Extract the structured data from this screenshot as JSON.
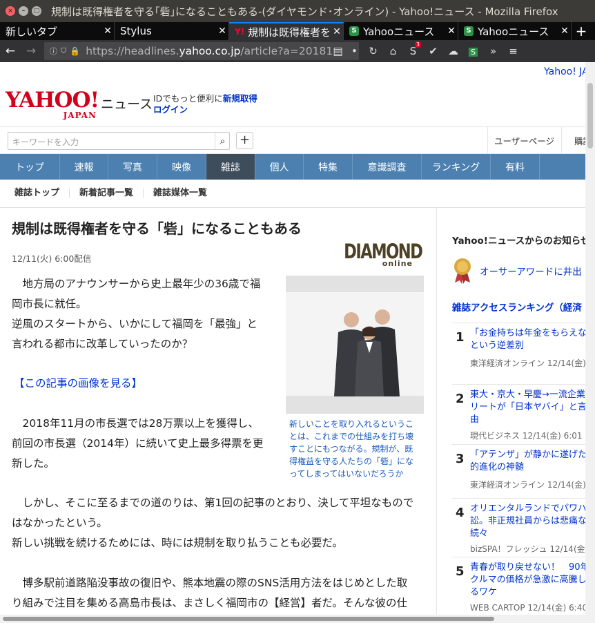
{
  "window": {
    "title": "規制は既得権者を守る｢砦｣になることもある-(ダイヤモンド･オンライン) - Yahoo!ニュース - Mozilla Firefox"
  },
  "tabs": [
    {
      "label": "新しいタブ"
    },
    {
      "label": "Stylus"
    },
    {
      "label": "規制は既得権者を守る"
    },
    {
      "label": "Yahooニュース"
    },
    {
      "label": "Yahooニュース"
    }
  ],
  "urlbar": {
    "proto": "https://headlines.",
    "host": "yahoo.co.jp",
    "path": "/article?a=20181"
  },
  "toolbar": {
    "badge_count": "3"
  },
  "header": {
    "top_link": "Yahoo! JA",
    "logo_main": "YAHOO!",
    "logo_sub": "JAPAN",
    "news_label": "ニュース",
    "id_text": "IDでもっと便利に",
    "signup": "新規取得",
    "login": "ログイン"
  },
  "search": {
    "placeholder": "キーワードを入力",
    "user_page": "ユーザーページ",
    "purchase": "購読"
  },
  "nav": [
    "トップ",
    "速報",
    "写真",
    "映像",
    "雑誌",
    "個人",
    "特集",
    "意識調査",
    "ランキング",
    "有料"
  ],
  "subnav": [
    "雑誌トップ",
    "新着記事一覧",
    "雑誌媒体一覧"
  ],
  "article": {
    "title": "規制は既得権者を守る「砦」になることもある",
    "date": "12/11(火) 6:00配信",
    "publisher_logo": "DIAMOND",
    "publisher_logo_sub": "online",
    "p1a": "　地方局のアナウンサーから史上最年少の36歳で福",
    "p1b": "岡市長に就任。",
    "p1c": "逆風のスタートから、いかにして福岡を「最強」と",
    "p1d": "言われる都市に改革していったのか？",
    "image_link": "【この記事の画像を見る】",
    "p2a": "　2018年11月の市長選では28万票以上を獲得し、",
    "p2b": "前回の市長選（2014年）に続いて史上最多得票を更",
    "p2c": "新した。",
    "p3a": "　しかし、そこに至るまでの道のりは、第1回の記事のとおり、決して平坦なもので",
    "p3b": "はなかったという。",
    "p3c": "新しい挑戦を続けるためには、時には規制を取り払うことも必要だ。",
    "p4a": "　博多駅前道路陥没事故の復旧や、熊本地震の際のSNS活用方法をはじめとした取",
    "p4b": "り組みで注目を集める高島市長は、まさしく福岡市の【経営】者だ。そんな彼の仕",
    "caption": "新しいことを取り入れるということは、これまでの仕組みを打ち壊すことにもつながる。規制が、既得権益を守る人たちの「砦」になってしまってはいないだろうか"
  },
  "sidebar": {
    "notice_heading": "Yahoo!ニュースからのお知らせ",
    "notice_link": "オーサーアワードに井出",
    "ranking_heading": "雑誌アクセスランキング（経済",
    "ranking": [
      {
        "num": "1",
        "l1": "「お金持ちは年金をもらえな",
        "l2": "という逆差別",
        "l3": "",
        "source": "東洋経済オンライン 12/14(金)"
      },
      {
        "num": "2",
        "l1": "東大・京大・早慶→一流企業",
        "l2": "リートが「日本ヤバイ」と言",
        "l3": "由",
        "source": "現代ビジネス 12/14(金) 6:01"
      },
      {
        "num": "3",
        "l1": "「アテンザ」が静かに遂げた",
        "l2": "的進化の神髄",
        "l3": "",
        "source": "東洋経済オンライン 12/14(金)"
      },
      {
        "num": "4",
        "l1": "オリエンタルランドでパワハ",
        "l2": "訟。非正規社員からは悲痛な",
        "l3": "続々",
        "source": "bizSPA！フレッシュ 12/14(金"
      },
      {
        "num": "5",
        "l1": "青春が取り戻せない！　90年",
        "l2": "クルマの価格が急激に高騰し",
        "l3": "るワケ",
        "source": "WEB CARTOP 12/14(金) 6:40"
      }
    ]
  },
  "colors": {
    "nav_bg": "#4b80b0",
    "nav_active": "#3d4d5c",
    "link": "#0033cc",
    "yahoo_red": "#d0011b",
    "tab_accent": "#0a84ff"
  }
}
